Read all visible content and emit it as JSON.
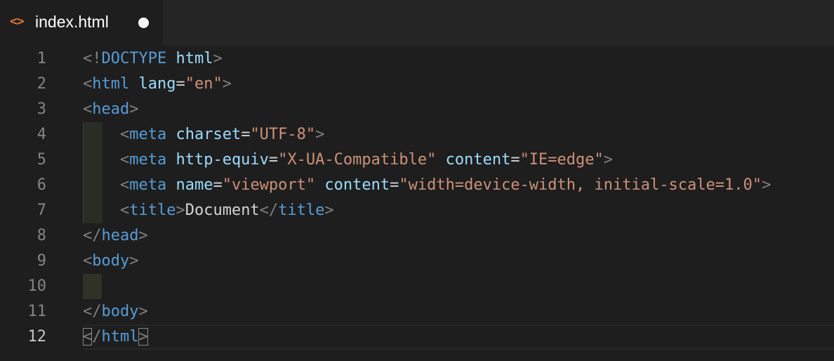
{
  "tab": {
    "icon": "html-code-icon",
    "icon_glyph": "<>",
    "label": "index.html",
    "modified": true
  },
  "editor": {
    "active_line": 12,
    "lines": [
      {
        "num": "1",
        "tokens": [
          [
            "p",
            "<!"
          ],
          [
            "t",
            "DOCTYPE"
          ],
          [
            "x",
            " "
          ],
          [
            "a",
            "html"
          ],
          [
            "p",
            ">"
          ]
        ]
      },
      {
        "num": "2",
        "tokens": [
          [
            "p",
            "<"
          ],
          [
            "t",
            "html"
          ],
          [
            "x",
            " "
          ],
          [
            "a",
            "lang"
          ],
          [
            "x",
            "="
          ],
          [
            "s",
            "\"en\""
          ],
          [
            "p",
            ">"
          ]
        ]
      },
      {
        "num": "3",
        "tokens": [
          [
            "p",
            "<"
          ],
          [
            "t",
            "head"
          ],
          [
            "p",
            ">"
          ]
        ]
      },
      {
        "num": "4",
        "tokens": [
          [
            "x",
            "    "
          ],
          [
            "p",
            "<"
          ],
          [
            "t",
            "meta"
          ],
          [
            "x",
            " "
          ],
          [
            "a",
            "charset"
          ],
          [
            "x",
            "="
          ],
          [
            "s",
            "\"UTF-8\""
          ],
          [
            "p",
            ">"
          ]
        ]
      },
      {
        "num": "5",
        "tokens": [
          [
            "x",
            "    "
          ],
          [
            "p",
            "<"
          ],
          [
            "t",
            "meta"
          ],
          [
            "x",
            " "
          ],
          [
            "a",
            "http-equiv"
          ],
          [
            "x",
            "="
          ],
          [
            "s",
            "\"X-UA-Compatible\""
          ],
          [
            "x",
            " "
          ],
          [
            "a",
            "content"
          ],
          [
            "x",
            "="
          ],
          [
            "s",
            "\"IE=edge\""
          ],
          [
            "p",
            ">"
          ]
        ]
      },
      {
        "num": "6",
        "tokens": [
          [
            "x",
            "    "
          ],
          [
            "p",
            "<"
          ],
          [
            "t",
            "meta"
          ],
          [
            "x",
            " "
          ],
          [
            "a",
            "name"
          ],
          [
            "x",
            "="
          ],
          [
            "s",
            "\"viewport\""
          ],
          [
            "x",
            " "
          ],
          [
            "a",
            "content"
          ],
          [
            "x",
            "="
          ],
          [
            "s",
            "\"width=device-width, initial-scale=1.0\""
          ],
          [
            "p",
            ">"
          ]
        ]
      },
      {
        "num": "7",
        "tokens": [
          [
            "x",
            "    "
          ],
          [
            "p",
            "<"
          ],
          [
            "t",
            "title"
          ],
          [
            "p",
            ">"
          ],
          [
            "x",
            "Document"
          ],
          [
            "p",
            "</"
          ],
          [
            "t",
            "title"
          ],
          [
            "p",
            ">"
          ]
        ]
      },
      {
        "num": "8",
        "tokens": [
          [
            "p",
            "</"
          ],
          [
            "t",
            "head"
          ],
          [
            "p",
            ">"
          ]
        ]
      },
      {
        "num": "9",
        "tokens": [
          [
            "p",
            "<"
          ],
          [
            "t",
            "body"
          ],
          [
            "p",
            ">"
          ]
        ]
      },
      {
        "num": "10",
        "tokens": []
      },
      {
        "num": "11",
        "tokens": [
          [
            "p",
            "</"
          ],
          [
            "t",
            "body"
          ],
          [
            "p",
            ">"
          ]
        ]
      },
      {
        "num": "12",
        "tokens": [
          [
            "pb",
            "<"
          ],
          [
            "p",
            "/"
          ],
          [
            "t",
            "html"
          ],
          [
            "pb",
            ">"
          ]
        ]
      }
    ]
  },
  "colors": {
    "editor_bg": "#1e1e1e",
    "tag": "#569cd6",
    "attribute": "#9cdcfe",
    "string": "#ce9178",
    "punctuation": "#808080",
    "text": "#d4d4d4",
    "tab_icon": "#e37933"
  }
}
